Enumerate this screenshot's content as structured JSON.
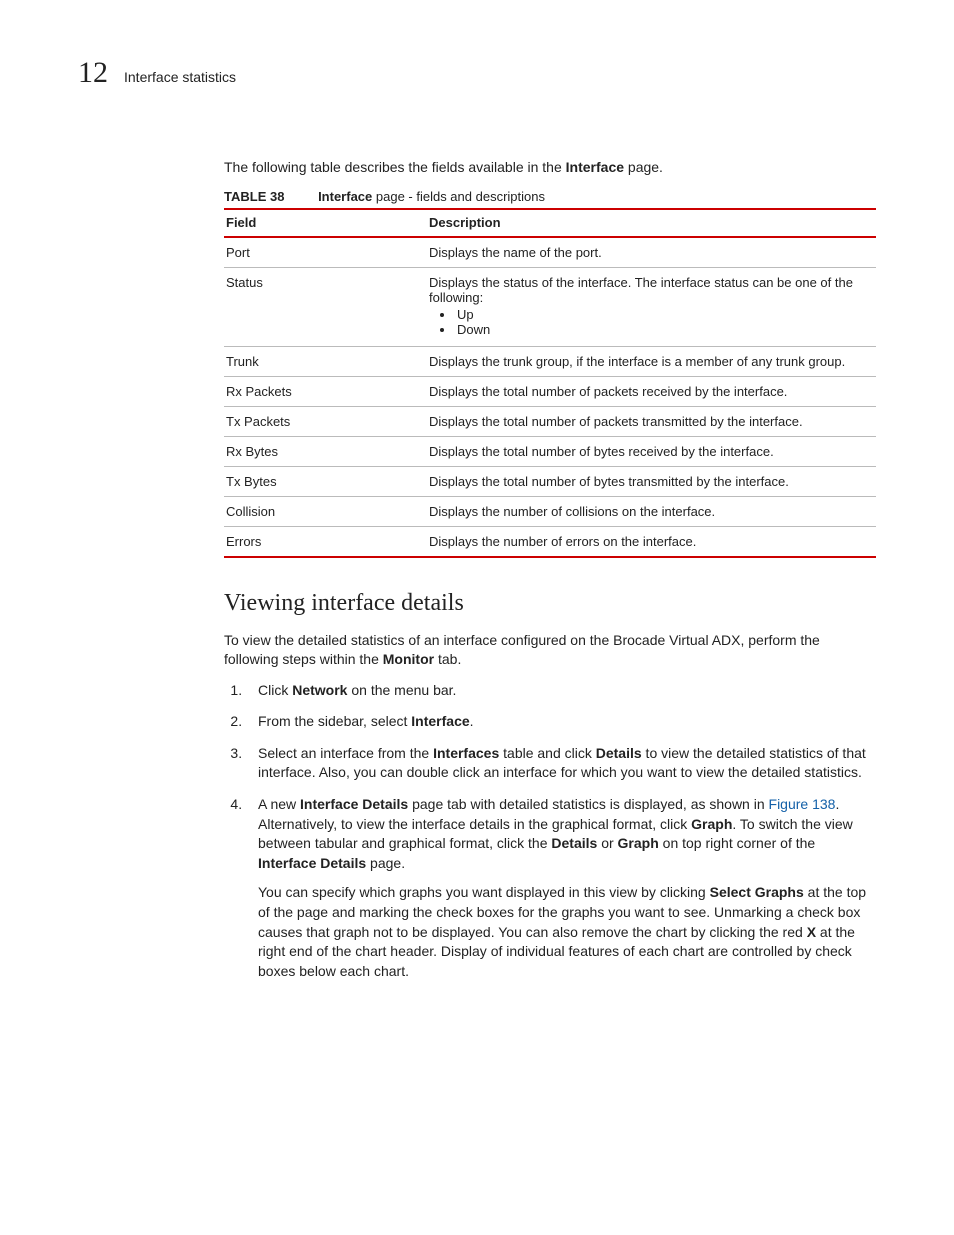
{
  "header": {
    "chapter_number": "12",
    "chapter_title": "Interface statistics"
  },
  "intro": {
    "prefix": "The following table describes the fields available in the ",
    "bold": "Interface",
    "suffix": " page."
  },
  "table": {
    "label": "TABLE 38",
    "caption_bold": "Interface",
    "caption_rest": " page - fields and descriptions",
    "head_field": "Field",
    "head_desc": "Description",
    "rows": {
      "port": {
        "f": "Port",
        "d": "Displays the name of the port."
      },
      "status": {
        "f": "Status",
        "d": "Displays the status of the interface. The interface status can be one of the following:",
        "b1": "Up",
        "b2": "Down"
      },
      "trunk": {
        "f": "Trunk",
        "d": "Displays the trunk group, if the interface is a member of any trunk group."
      },
      "rxp": {
        "f": "Rx Packets",
        "d": "Displays the total number of packets received by the interface."
      },
      "txp": {
        "f": "Tx Packets",
        "d": "Displays the total number of packets transmitted by the interface."
      },
      "rxb": {
        "f": "Rx Bytes",
        "d": "Displays the total number of bytes received by the interface."
      },
      "txb": {
        "f": "Tx Bytes",
        "d": "Displays the total number of bytes transmitted by the interface."
      },
      "col": {
        "f": "Collision",
        "d": "Displays the number of collisions on the interface."
      },
      "err": {
        "f": "Errors",
        "d": "Displays the number of errors on the interface."
      }
    }
  },
  "section_heading": "Viewing interface details",
  "section_intro": {
    "p1": "To view the detailed statistics of an interface configured on the Brocade Virtual ADX, perform the following steps within the ",
    "b1": "Monitor",
    "p2": " tab."
  },
  "steps": {
    "s1": {
      "t1": "Click ",
      "b1": "Network",
      "t2": " on the menu bar."
    },
    "s2": {
      "t1": "From the sidebar, select ",
      "b1": "Interface",
      "t2": "."
    },
    "s3": {
      "t1": "Select an interface from the ",
      "b1": "Interfaces",
      "t2": " table and click ",
      "b2": "Details",
      "t3": " to view the detailed statistics of that interface. Also, you can double click an interface for which you want to view the detailed statistics."
    },
    "s4": {
      "t1": "A new ",
      "b1": "Interface Details",
      "t2": " page tab with detailed statistics is displayed, as shown in ",
      "link": "Figure 138",
      "t3": ". Alternatively, to view the interface details in the graphical format, click ",
      "b2": "Graph",
      "t4": ". To switch the view between tabular and graphical format, click the ",
      "b3": "Details",
      "t5": " or ",
      "b4": "Graph",
      "t6": " on top right corner of the ",
      "b5": "Interface Details",
      "t7": " page.",
      "p2a": "You can specify which graphs you want displayed in this view by clicking ",
      "p2b": "Select Graphs",
      "p2c": " at the top of the page and marking the check boxes for the graphs you want to see. Unmarking a check box causes that graph not to be displayed. You can also remove the chart by clicking the red ",
      "p2d": "X",
      "p2e": " at the right end of the chart header. Display of individual features of each chart are controlled by check boxes below each chart."
    }
  }
}
